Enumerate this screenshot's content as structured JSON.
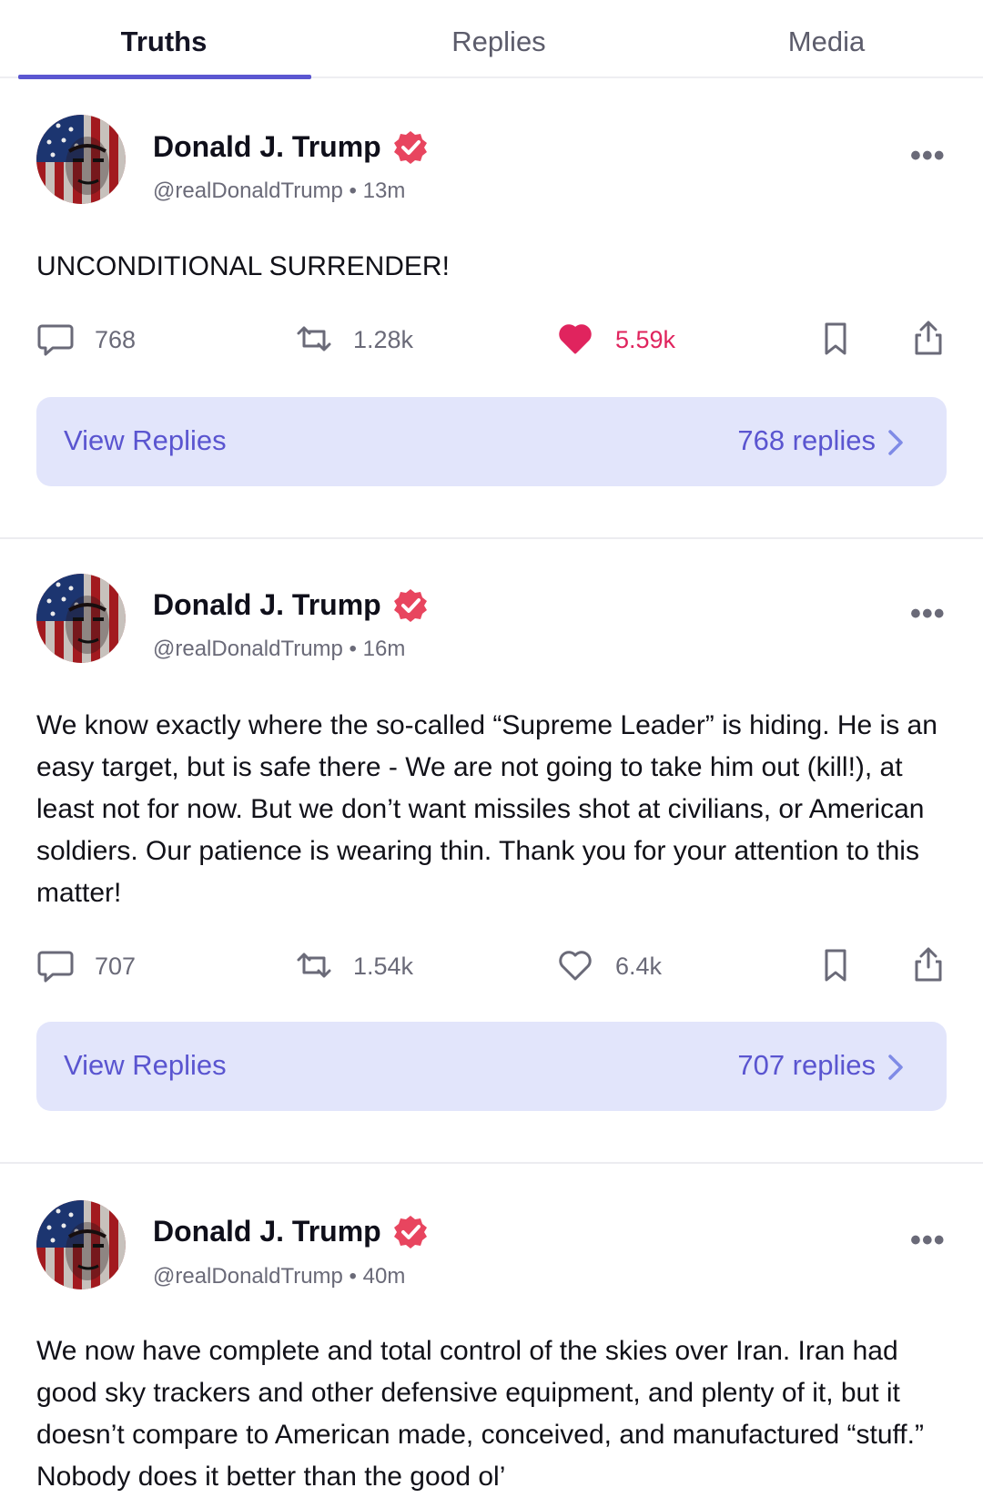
{
  "tabs": [
    {
      "label": "Truths",
      "active": true
    },
    {
      "label": "Replies",
      "active": false
    },
    {
      "label": "Media",
      "active": false
    }
  ],
  "colors": {
    "accent": "#5b57d1",
    "verified": "#e8455f",
    "liked": "#e0245e",
    "reply_box": "#e2e5fb"
  },
  "posts": [
    {
      "author": "Donald J. Trump",
      "handle": "@realDonaldTrump",
      "time": "13m",
      "meta": "@realDonaldTrump • 13m",
      "text": "UNCONDITIONAL SURRENDER!",
      "replies": "768",
      "retruths": "1.28k",
      "likes": "5.59k",
      "liked": true,
      "view_replies_label": "View Replies",
      "replies_label": "768 replies"
    },
    {
      "author": "Donald J. Trump",
      "handle": "@realDonaldTrump",
      "time": "16m",
      "meta": "@realDonaldTrump • 16m",
      "text": "We know exactly where the so-called “Supreme Leader” is hiding. He is an easy target, but is safe there - We are not going to take him out (kill!), at least not for now. But we don’t want missiles shot at civilians, or American soldiers. Our patience is wearing thin. Thank you for your attention to this matter!",
      "replies": "707",
      "retruths": "1.54k",
      "likes": "6.4k",
      "liked": false,
      "view_replies_label": "View Replies",
      "replies_label": "707 replies"
    },
    {
      "author": "Donald J. Trump",
      "handle": "@realDonaldTrump",
      "time": "40m",
      "meta": "@realDonaldTrump • 40m",
      "text": "We now have complete and total control of the skies over Iran. Iran had good sky trackers and other defensive equipment, and plenty of it, but it doesn’t compare to American made, conceived, and manufactured “stuff.” Nobody does it better than the good ol’"
    }
  ],
  "icons": {
    "reply": "comment-icon",
    "retruth": "retruth-icon",
    "like": "heart-icon",
    "bookmark": "bookmark-icon",
    "share": "share-icon",
    "more": "more-icon",
    "verified": "verified-badge-icon",
    "chevron": "chevron-right-icon"
  }
}
